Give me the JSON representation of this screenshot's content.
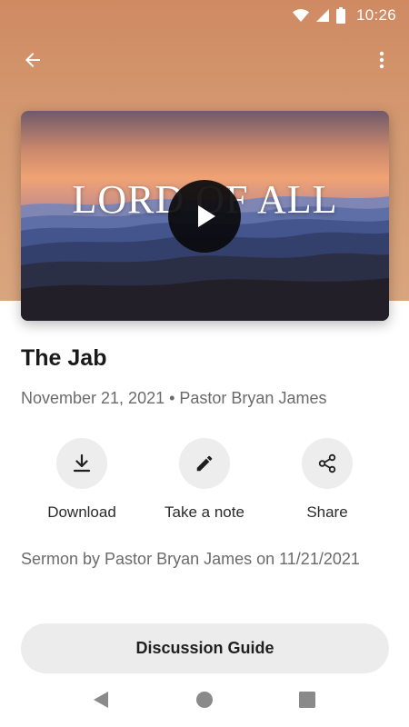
{
  "status_bar": {
    "time": "10:26",
    "icons": [
      "wifi-icon",
      "cellular-signal-icon",
      "battery-icon"
    ]
  },
  "app_bar": {
    "back_icon": "arrow-left-icon",
    "menu_icon": "more-vertical-icon"
  },
  "video": {
    "overlay_title": "LORD OF ALL",
    "play_icon": "play-icon"
  },
  "sermon": {
    "title": "The Jab",
    "meta": "November 21, 2021 • Pastor Bryan James",
    "description": "Sermon by Pastor Bryan James on 11/21/2021"
  },
  "actions": [
    {
      "label": "Download",
      "icon": "download-icon"
    },
    {
      "label": "Take a note",
      "icon": "pencil-icon"
    },
    {
      "label": "Share",
      "icon": "share-icon"
    }
  ],
  "discussion_guide": {
    "label": "Discussion Guide"
  },
  "colors": {
    "hero_background": "#d49a72",
    "button_background": "#ececed",
    "secondary_text": "#6b6b6b"
  }
}
